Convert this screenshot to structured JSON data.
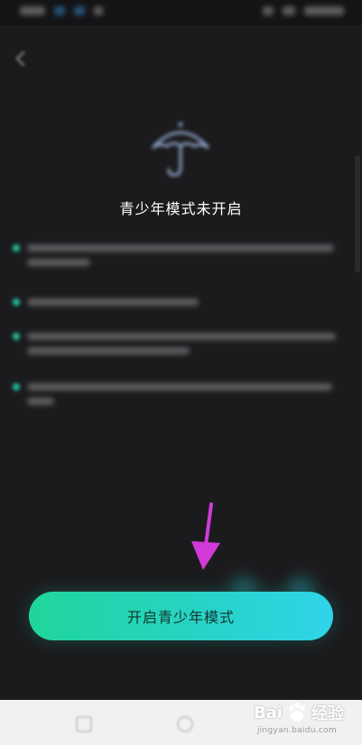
{
  "page": {
    "title": "青少年模式未开启",
    "primary_button_label": "开启青少年模式"
  },
  "features": [
    {
      "id": 1
    },
    {
      "id": 2
    },
    {
      "id": 3
    },
    {
      "id": 4
    }
  ],
  "colors": {
    "background": "#1b1b1d",
    "accent_start": "#1fd59b",
    "accent_end": "#2fd4ea",
    "annotation_arrow": "#d23ad8"
  },
  "icons": {
    "back": "back-arrow-icon",
    "hero": "umbrella-icon",
    "annotation": "pointer-arrow-icon"
  },
  "watermark": {
    "brand": "Bai",
    "brand_suffix": "经验",
    "subtext": "jingyan.baidu.com"
  }
}
